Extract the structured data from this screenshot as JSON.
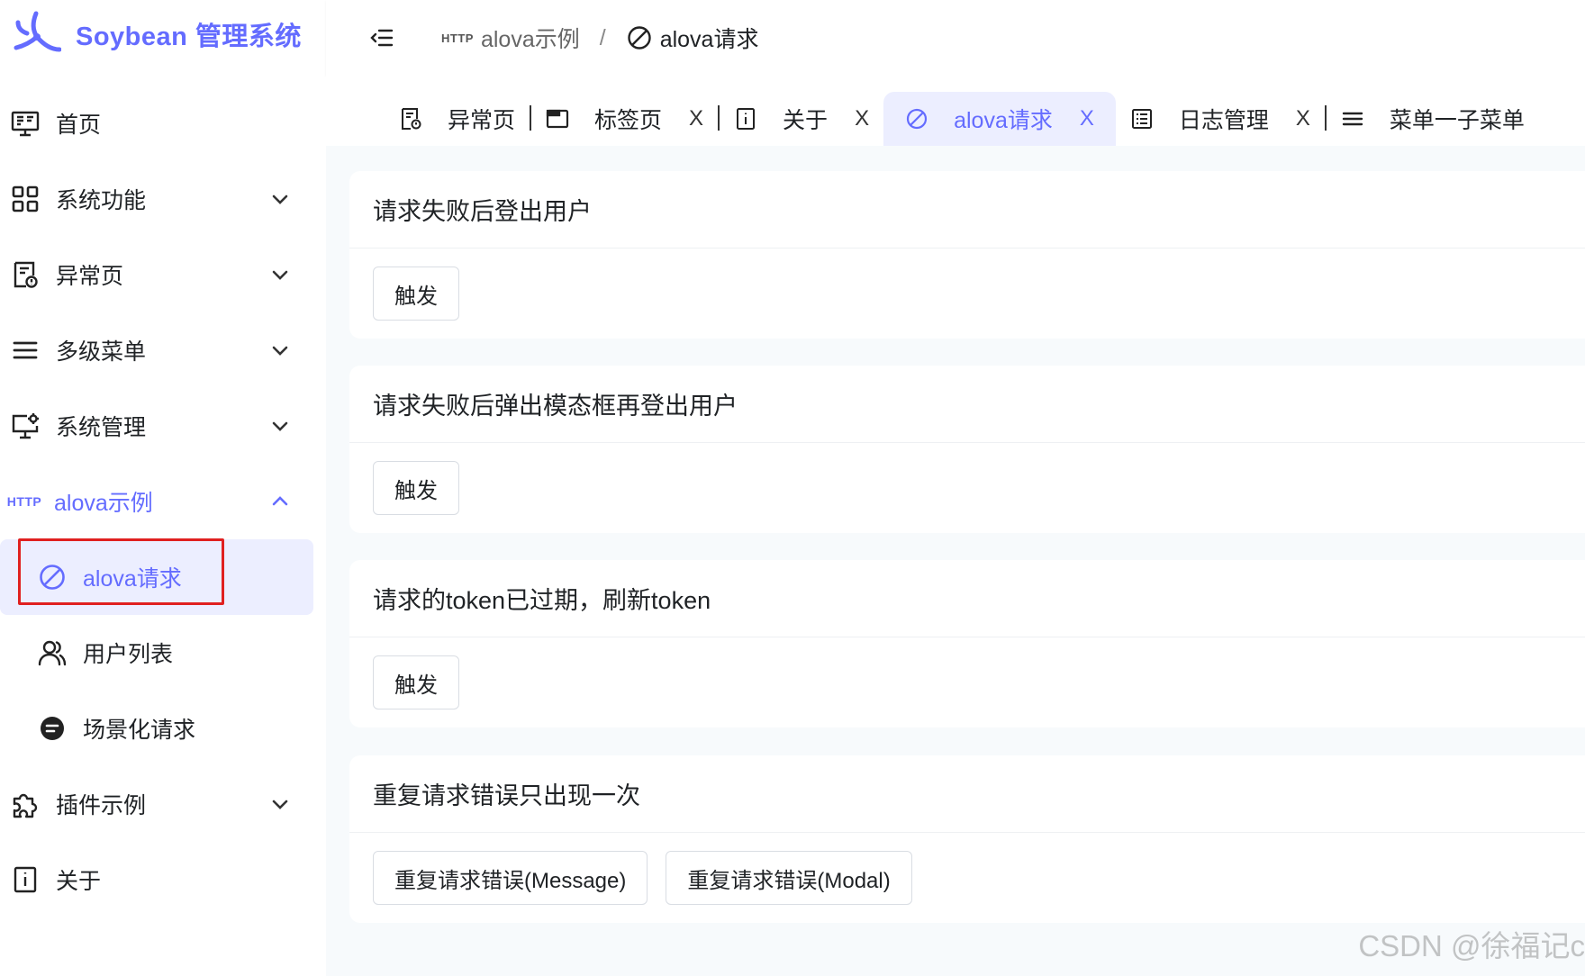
{
  "app": {
    "title": "Soybean 管理系统",
    "brand_color": "#646cff"
  },
  "sidebar": {
    "items": [
      {
        "label": "首页",
        "icon": "monitor-icon"
      },
      {
        "label": "系统功能",
        "icon": "grid-icon"
      },
      {
        "label": "异常页",
        "icon": "exception-doc-icon"
      },
      {
        "label": "多级菜单",
        "icon": "menu-icon"
      },
      {
        "label": "系统管理",
        "icon": "monitor-gear-icon"
      },
      {
        "label": "alova示例",
        "icon": "http-icon"
      },
      {
        "label": "alova请求",
        "icon": "forbidden-icon"
      },
      {
        "label": "用户列表",
        "icon": "users-icon"
      },
      {
        "label": "场景化请求",
        "icon": "chat-bubble-icon"
      },
      {
        "label": "插件示例",
        "icon": "puzzle-icon"
      },
      {
        "label": "关于",
        "icon": "info-icon"
      }
    ]
  },
  "header": {
    "http_badge": "HTTP",
    "breadcrumb": [
      "alova示例",
      "alova请求"
    ],
    "separator": "/"
  },
  "tabs": [
    {
      "label": "异常页",
      "closable": false
    },
    {
      "label": "标签页",
      "closable": true
    },
    {
      "label": "关于",
      "closable": true
    },
    {
      "label": "alova请求",
      "closable": true,
      "active": true
    },
    {
      "label": "日志管理",
      "closable": true
    },
    {
      "label": "菜单一子菜单",
      "closable": false
    }
  ],
  "close_glyph": "X",
  "cards": [
    {
      "title": "请求失败后登出用户",
      "buttons": [
        "触发"
      ]
    },
    {
      "title": "请求失败后弹出模态框再登出用户",
      "buttons": [
        "触发"
      ]
    },
    {
      "title": "请求的token已过期，刷新token",
      "buttons": [
        "触发"
      ]
    },
    {
      "title": "重复请求错误只出现一次",
      "buttons": [
        "重复请求错误(Message)",
        "重复请求错误(Modal)"
      ]
    }
  ],
  "watermark": "CSDN @徐福记c"
}
